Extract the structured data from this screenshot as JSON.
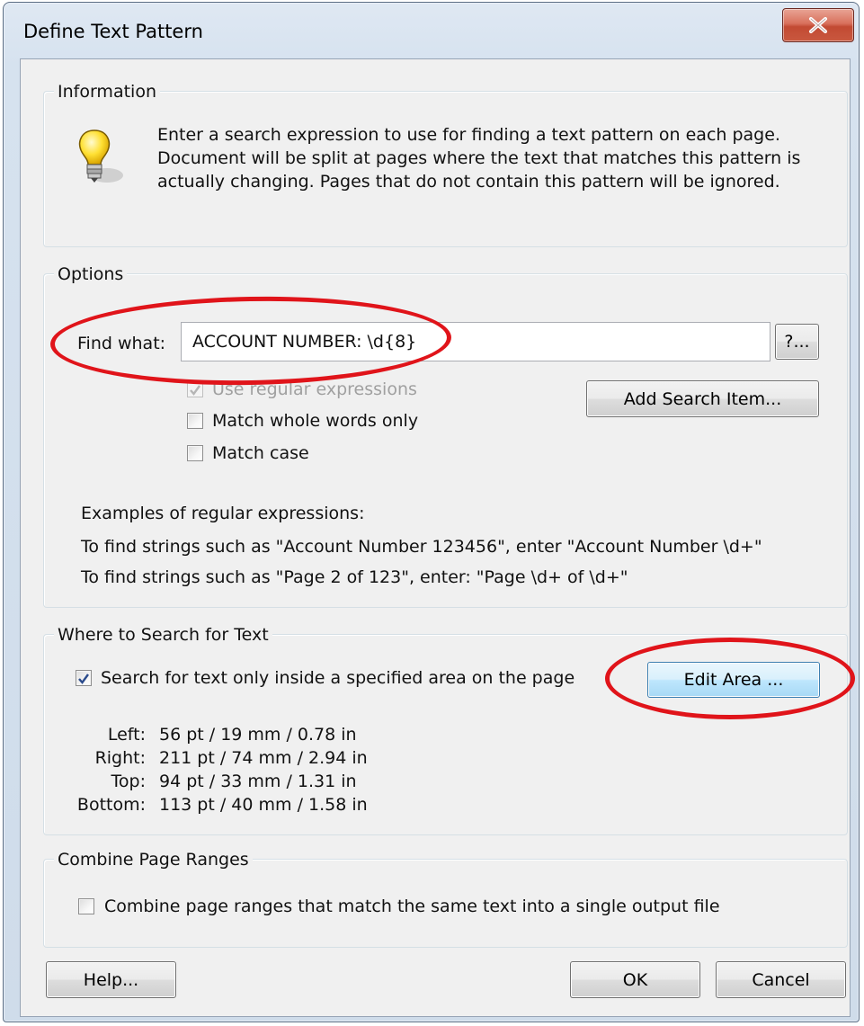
{
  "window": {
    "title": "Define Text Pattern",
    "close_label": "X"
  },
  "information": {
    "label": "Information",
    "icon": "lightbulb-icon",
    "lines": [
      "Enter a search expression to use for finding a text pattern on each page.",
      "Document will be split at pages where the text that matches this pattern is",
      "actually changing. Pages that do not contain this pattern will be ignored."
    ]
  },
  "options": {
    "label": "Options",
    "find_label": "Find what:",
    "find_value": "ACCOUNT NUMBER: \\d{8}",
    "help_button": "?...",
    "add_search_item": "Add Search Item...",
    "use_regex": {
      "label": "Use regular expressions",
      "checked": true,
      "enabled": false
    },
    "match_whole": {
      "label": "Match whole words only",
      "checked": false
    },
    "match_case": {
      "label": "Match case",
      "checked": false
    },
    "examples_heading": "Examples of regular expressions:",
    "example_1": "To find strings such as \"Account Number 123456\", enter \"Account Number \\d+\"",
    "example_2": "To find strings such as \"Page 2 of 123\", enter: \"Page \\d+ of \\d+\""
  },
  "where": {
    "label": "Where to Search for Text",
    "search_area": {
      "label": "Search for text only inside a specified area on the page",
      "checked": true
    },
    "edit_area": "Edit Area ...",
    "coords": [
      {
        "name": "Left:",
        "value": "56 pt / 19 mm / 0.78 in"
      },
      {
        "name": "Right:",
        "value": "211 pt / 74 mm / 2.94 in"
      },
      {
        "name": "Top:",
        "value": "94 pt / 33 mm / 1.31 in"
      },
      {
        "name": "Bottom:",
        "value": "113 pt / 40 mm / 1.58 in"
      }
    ]
  },
  "combine": {
    "label": "Combine Page Ranges",
    "checkbox": {
      "label": "Combine page ranges that match the same text into a single output file",
      "checked": false
    }
  },
  "buttons": {
    "help": "Help...",
    "ok": "OK",
    "cancel": "Cancel"
  },
  "colors": {
    "annotation": "#e0141a",
    "window_frame": "#d6e2ef",
    "client": "#f0f0f0"
  }
}
